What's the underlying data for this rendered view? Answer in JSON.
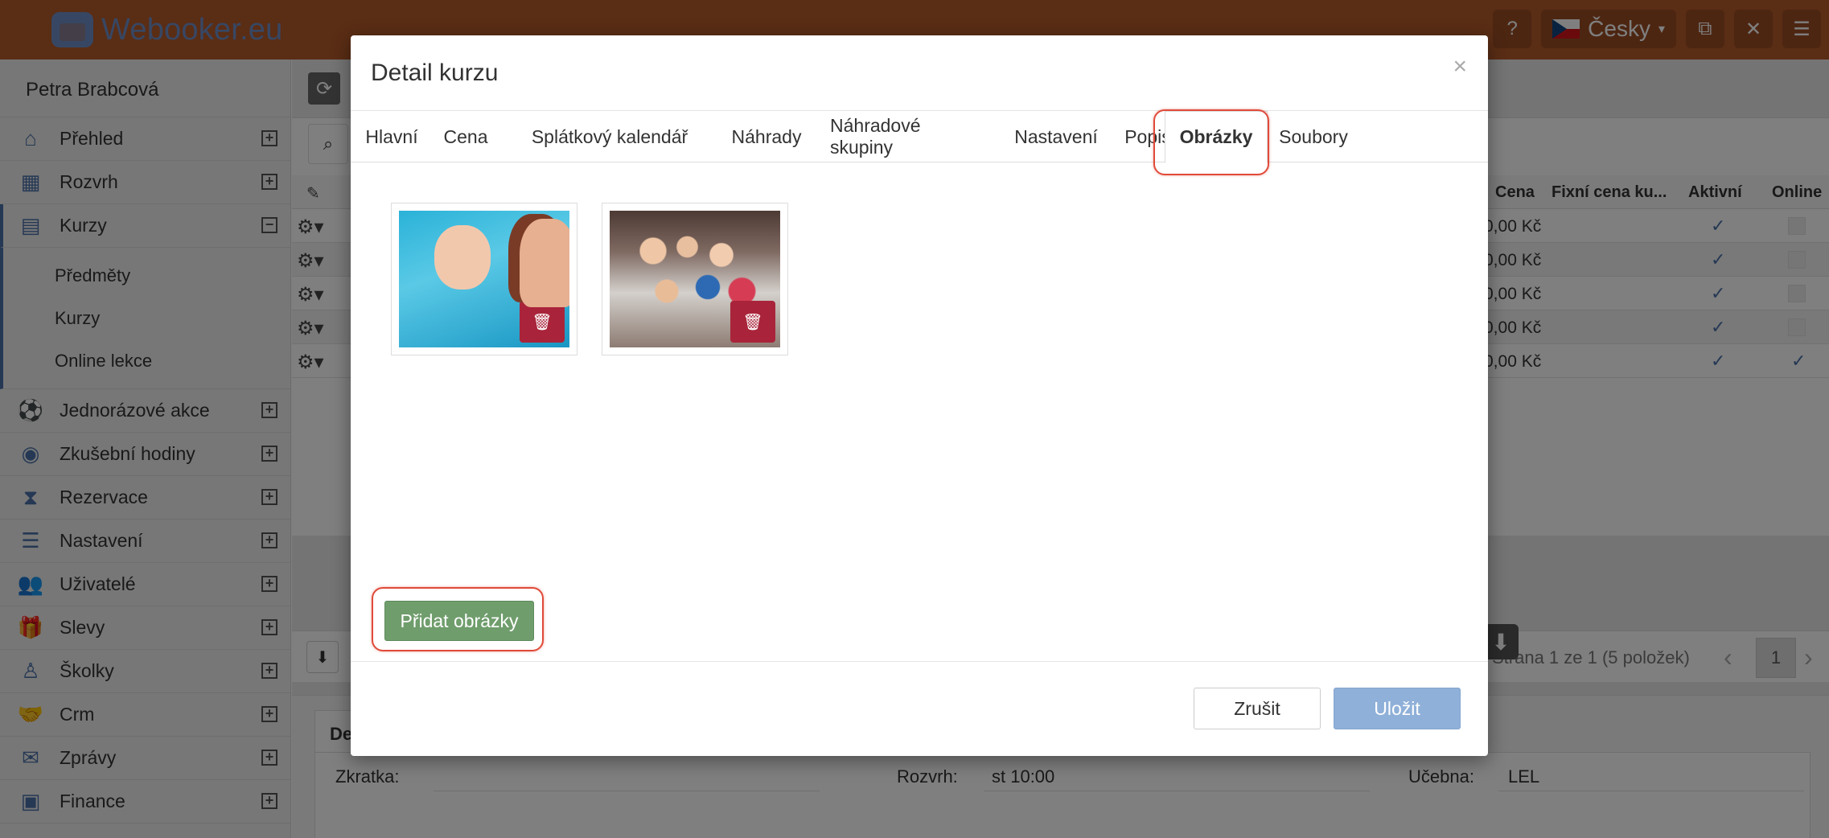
{
  "app": {
    "logo_text": "Webooker.eu",
    "language": "Česky"
  },
  "sidebar": {
    "user_name": "Petra Brabcová",
    "items": [
      {
        "label": "Přehled",
        "icon": "home-icon"
      },
      {
        "label": "Rozvrh",
        "icon": "calendar-icon"
      },
      {
        "label": "Kurzy",
        "icon": "book-icon"
      },
      {
        "label": "Jednorázové akce",
        "icon": "ball-icon"
      },
      {
        "label": "Zkušební hodiny",
        "icon": "eye-icon"
      },
      {
        "label": "Rezervace",
        "icon": "hourglass-icon"
      },
      {
        "label": "Nastavení",
        "icon": "server-icon"
      },
      {
        "label": "Uživatelé",
        "icon": "users-icon"
      },
      {
        "label": "Slevy",
        "icon": "gift-icon"
      },
      {
        "label": "Školky",
        "icon": "child-icon"
      },
      {
        "label": "Crm",
        "icon": "handshake-icon"
      },
      {
        "label": "Zprávy",
        "icon": "envelope-icon"
      },
      {
        "label": "Finance",
        "icon": "money-icon"
      }
    ],
    "sub_items": [
      "Předměty",
      "Kurzy",
      "Online lekce"
    ]
  },
  "grid": {
    "headers": {
      "cena": "Cena",
      "fixni": "Fixní cena ku...",
      "aktivni": "Aktivní",
      "online": "Online"
    },
    "rows": [
      {
        "cena": "0,00 Kč",
        "aktivni": true,
        "online": false
      },
      {
        "cena": "0,00 Kč",
        "aktivni": true,
        "online": false
      },
      {
        "cena": "0,00 Kč",
        "aktivni": true,
        "online": false
      },
      {
        "cena": "0,00 Kč",
        "aktivni": true,
        "online": false
      },
      {
        "cena": "0,00 Kč",
        "aktivni": true,
        "online": true
      }
    ],
    "pager_text": "Strana 1 ze 1 (5 položek)",
    "page": "1"
  },
  "detail": {
    "tab": "De",
    "zkratka_label": "Zkratka:",
    "rozvrh_label": "Rozvrh:",
    "rozvrh_value": "st 10:00",
    "ucebna_label": "Učebna:",
    "ucebna_value": "LEL"
  },
  "modal": {
    "title": "Detail kurzu",
    "close": "×",
    "tabs": [
      "Hlavní",
      "Cena",
      "Splátkový kalendář",
      "Náhrady",
      "Náhradové skupiny",
      "Nastavení",
      "Popis",
      "Obrázky",
      "Soubory"
    ],
    "active_tab": "Obrázky",
    "add_button": "Přidat obrázky",
    "cancel_button": "Zrušit",
    "save_button": "Uložit"
  },
  "colors": {
    "topbar": "#b45a2a",
    "accent": "#4a70a8",
    "danger": "#a9243a",
    "success": "#6f9d6c",
    "highlight": "#e04b3a"
  }
}
